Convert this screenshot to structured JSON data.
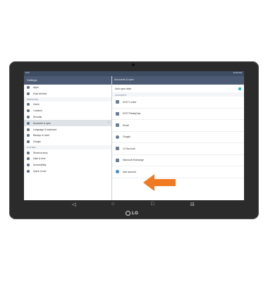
{
  "status_bar": {
    "time": "9:41",
    "right": "12:00 AM"
  },
  "left_pane": {
    "title": "Settings",
    "items_top": [
      {
        "label": "Apps",
        "icon": "apps-icon"
      },
      {
        "label": "Dual window",
        "icon": "dual-window-icon"
      }
    ],
    "section_personal": "PERSONAL",
    "items_personal": [
      {
        "label": "Users",
        "icon": "users-icon"
      },
      {
        "label": "Location",
        "icon": "location-icon"
      },
      {
        "label": "Security",
        "icon": "lock-icon"
      },
      {
        "label": "Accounts & sync",
        "icon": "accounts-icon",
        "selected": true
      },
      {
        "label": "Language & keyboard",
        "icon": "language-icon"
      },
      {
        "label": "Backup & reset",
        "icon": "backup-icon"
      },
      {
        "label": "Google",
        "icon": "google-icon"
      }
    ],
    "section_system": "SYSTEM",
    "items_system": [
      {
        "label": "Shortcut keys",
        "icon": "shortcut-keys-icon"
      },
      {
        "label": "Date & time",
        "icon": "clock-icon"
      },
      {
        "label": "Accessibility",
        "icon": "accessibility-icon"
      },
      {
        "label": "Quick Cover",
        "icon": "quick-cover-icon"
      }
    ]
  },
  "right_pane": {
    "title": "Accounts & sync",
    "auto_sync": {
      "label": "Auto-sync data",
      "checked": true
    },
    "section_accounts": "ACCOUNTS",
    "accounts": [
      {
        "label": "AT&T Locker",
        "icon": "att-locker-icon"
      },
      {
        "label": "AT&T ReadyOps",
        "icon": "att-readyops-icon"
      },
      {
        "label": "Email",
        "icon": "email-icon"
      },
      {
        "label": "Google",
        "icon": "google-icon"
      },
      {
        "label": "LG Account",
        "icon": "lg-account-icon"
      },
      {
        "label": "Microsoft Exchange",
        "icon": "exchange-icon"
      },
      {
        "label": "Add account",
        "icon": "add-icon"
      }
    ]
  },
  "nav": {
    "back": "◁",
    "home": "○",
    "recents": "□",
    "menu": "⊟"
  },
  "device": {
    "brand": "LG"
  },
  "colors": {
    "header": "#4c5b73",
    "statusbar": "#3f4d63",
    "accent": "#36b7c8",
    "arrow": "#f07a22"
  }
}
